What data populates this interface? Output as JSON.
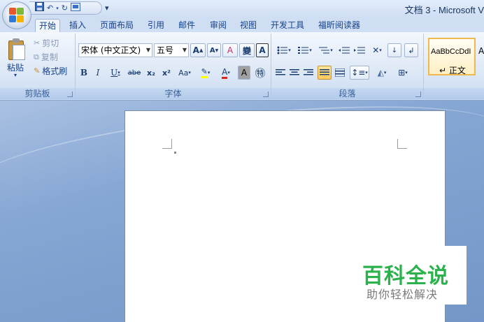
{
  "titlebar": {
    "doc_title": "文档 3 - Microsoft V",
    "qat_icons": [
      "save-icon",
      "undo-icon",
      "redo-icon",
      "print-preview-icon"
    ],
    "qat_more": "▾"
  },
  "tabs": [
    {
      "label": "开始",
      "active": true
    },
    {
      "label": "插入"
    },
    {
      "label": "页面布局"
    },
    {
      "label": "引用"
    },
    {
      "label": "邮件"
    },
    {
      "label": "审阅"
    },
    {
      "label": "视图"
    },
    {
      "label": "开发工具"
    },
    {
      "label": "福昕阅读器"
    }
  ],
  "clipboard": {
    "paste": "粘贴",
    "paste_arrow": "▾",
    "cut": "剪切",
    "copy": "复制",
    "format_painter": "格式刷",
    "group_label": "剪贴板"
  },
  "font": {
    "font_name": "宋体 (中文正文)",
    "font_size": "五号",
    "grow": "A",
    "shrink": "A",
    "clear_format": "A",
    "phonetic": "變",
    "char_border": "A",
    "bold": "B",
    "italic": "I",
    "underline": "U",
    "strike": "abe",
    "subscript": "x₂",
    "superscript": "x²",
    "change_case": "Aa",
    "highlight": "ab",
    "font_color": "A",
    "char_shade": "A",
    "enclose": "㊕",
    "group_label": "字体"
  },
  "paragraph": {
    "group_label": "段落"
  },
  "styles": {
    "sample": "AaBbCcDdI",
    "name": "↵ 正文",
    "next_sample": "A"
  },
  "watermark": {
    "title": "百科全说",
    "subtitle": "助你轻松解决"
  },
  "colors": {
    "ribbon_text": "#15428b",
    "watermark_green": "#2bb24c",
    "style_highlight": "#f0b94d"
  }
}
